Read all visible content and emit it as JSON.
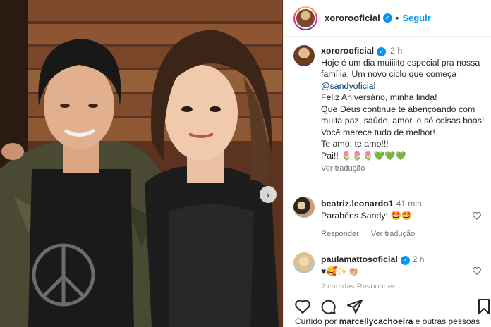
{
  "post": {
    "username": "xororooficial",
    "follow_label": "Seguir",
    "header_dot": "•"
  },
  "caption": {
    "username": "xororooficial",
    "time": "2 h",
    "line1": "Hoje é um dia muiiiito especial pra nossa família. Um novo ciclo que começa ",
    "mention": "@sandyoficial",
    "line2": "Feliz Aniversário, minha linda!",
    "line3": "Que Deus continue te abençoando com muita paz, saúde, amor, e só coisas boas!",
    "line4": "Você merece tudo de melhor!",
    "line5": "Te amo, te amo!!!",
    "line6": "Pai!! 🌷🌷🌷💚💚💚",
    "see_translation": "Ver tradução"
  },
  "comments": [
    {
      "username": "beatriz.leonardo1",
      "time": "41 min",
      "text": "Parabéns Sandy! 🤩🤩",
      "reply": "Responder",
      "translate": "Ver tradução"
    },
    {
      "username": "paulamattosoficial",
      "time": "2 h",
      "text": "♥🥰✨👏🏼"
    }
  ],
  "partial_text": "2 curtidas   Responder",
  "liked_by": {
    "prefix": "Curtido por ",
    "user": "marcellycachoeira",
    "suffix": " e outras pessoas"
  },
  "icons": [
    "heart-icon",
    "comment-icon",
    "share-icon",
    "bookmark-icon",
    "verified-icon",
    "chevron-right-icon"
  ],
  "colors": {
    "accent": "#0095f6",
    "text": "#262626",
    "muted": "#737373"
  }
}
